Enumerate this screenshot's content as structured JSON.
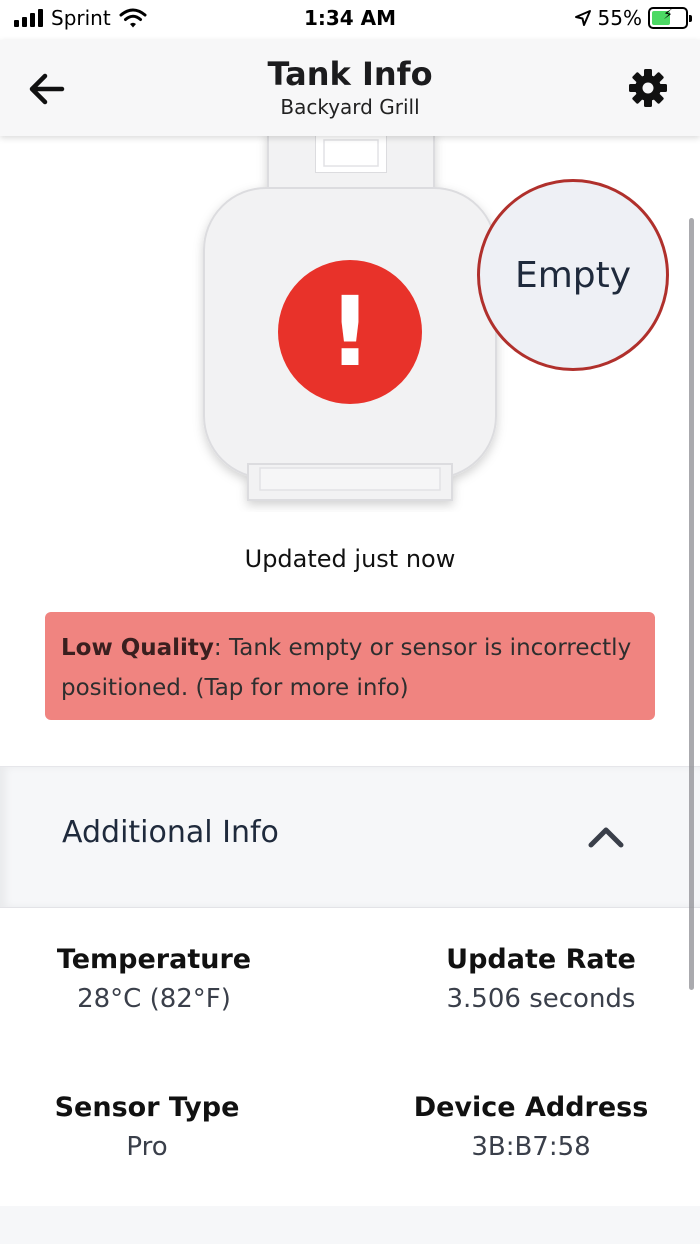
{
  "status_bar": {
    "carrier": "Sprint",
    "time": "1:34 AM",
    "battery_percent": "55%",
    "battery_level": 0.55,
    "icons": [
      "signal-bars-icon",
      "wifi-icon",
      "location-arrow-icon",
      "battery-charging-icon"
    ]
  },
  "header": {
    "title": "Tank Info",
    "subtitle": "Backyard Grill",
    "back_icon": "arrow-left-icon",
    "settings_icon": "gear-icon"
  },
  "tank": {
    "level_label": "Empty",
    "alert_symbol": "!",
    "alert_color": "#e8322a",
    "badge_border_color": "#b0302c"
  },
  "updated_text": "Updated just now",
  "warning": {
    "bold": "Low Quality",
    "message": ": Tank empty or sensor is incorrectly positioned. (Tap for more info)",
    "background": "#f08480"
  },
  "additional_info": {
    "title": "Additional Info",
    "toggle_icon": "chevron-up-icon",
    "items": [
      {
        "label": "Temperature",
        "value": "28°C (82°F)"
      },
      {
        "label": "Update Rate",
        "value": "3.506 seconds"
      },
      {
        "label": "Sensor Type",
        "value": "Pro"
      },
      {
        "label": "Device Address",
        "value": "3B:B7:58"
      }
    ]
  }
}
